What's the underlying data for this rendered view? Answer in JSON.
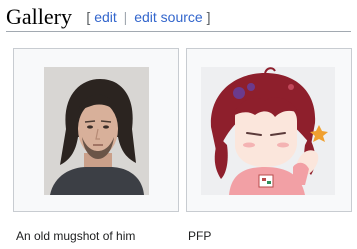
{
  "section": {
    "title": "Gallery",
    "edit_label": "edit",
    "edit_source_label": "edit source",
    "bracket_open": "[",
    "bracket_close": "]",
    "separator": "|"
  },
  "gallery": {
    "items": [
      {
        "caption": "An old mugshot of him",
        "image_kind": "mugshot-photo"
      },
      {
        "caption": "PFP",
        "image_kind": "anime-avatar-illustration"
      }
    ]
  },
  "colors": {
    "link": "#3366cc",
    "gallery_background": "#f8f9fa",
    "gallery_border": "#c8ccd1",
    "heading_rule": "#a2a9b1"
  }
}
